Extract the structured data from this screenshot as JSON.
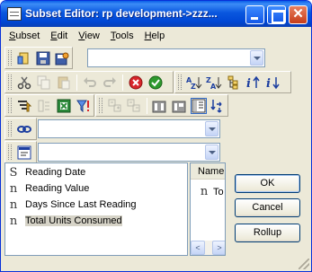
{
  "window": {
    "title": "Subset Editor:  rp development->zzz..."
  },
  "menu": [
    "Subset",
    "Edit",
    "View",
    "Tools",
    "Help"
  ],
  "menu_accelerators": [
    "S",
    "E",
    "V",
    "T",
    "H"
  ],
  "toolbar1": {
    "icons": [
      "open-subset-icon",
      "save-subset-icon",
      "save-as-icon"
    ],
    "combo_value": ""
  },
  "toolbar2": {
    "icons": [
      "cut-icon",
      "copy-icon",
      "paste-icon",
      "undo-icon",
      "redo-icon",
      "delete-icon",
      "keep-icon",
      "sort-ascending-icon",
      "sort-descending-icon",
      "hierarchy-sort-icon",
      "sort-index-up-icon",
      "sort-index-down-icon"
    ]
  },
  "toolbar3": {
    "icons": [
      "filter-by-level-icon",
      "filter-by-expression-icon",
      "filter-by-excel-icon",
      "filter-icon",
      "expand-icon",
      "collapse-icon",
      "show-attribute-icon",
      "hide-attribute-icon",
      "properties-icon",
      "drill-icon"
    ]
  },
  "toolbar4": {
    "combo_value": ""
  },
  "toolbar5": {
    "combo_value": ""
  },
  "elements": [
    {
      "type_glyph": "S",
      "label": "Reading Date",
      "selected": false
    },
    {
      "type_glyph": "n",
      "label": "Reading Value",
      "selected": false
    },
    {
      "type_glyph": "n",
      "label": "Days Since Last Reading",
      "selected": false
    },
    {
      "type_glyph": "n",
      "label": "Total Units Consumed",
      "selected": true
    }
  ],
  "attribute_pane": {
    "header": "Name",
    "row_glyph": "n",
    "row_label": "To"
  },
  "buttons": {
    "ok": "OK",
    "cancel": "Cancel",
    "rollup": "Rollup"
  }
}
